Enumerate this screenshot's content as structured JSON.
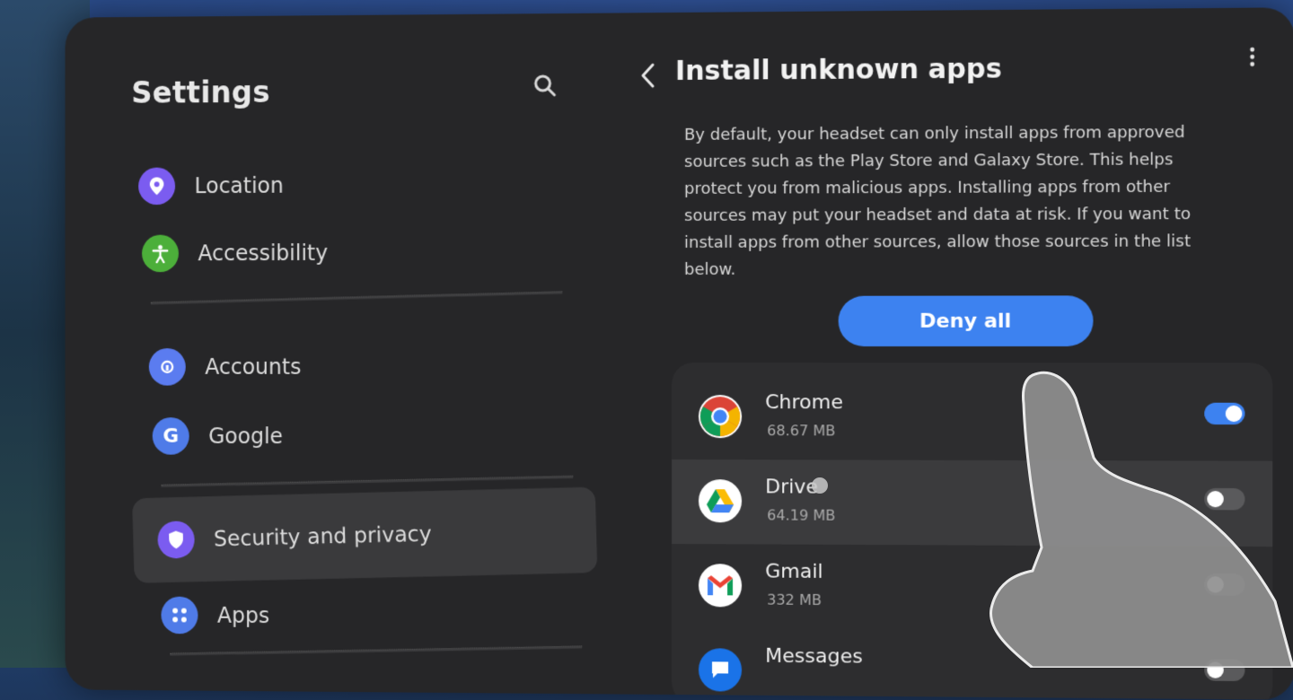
{
  "sidebar": {
    "title": "Settings",
    "items": [
      {
        "label": "Location",
        "icon": "location-pin-icon",
        "color": "#7b5cf0"
      },
      {
        "label": "Accessibility",
        "icon": "accessibility-person-icon",
        "color": "#4caf3a"
      },
      {
        "label": "Accounts",
        "icon": "key-icon",
        "color": "#5b7cf0"
      },
      {
        "label": "Google",
        "icon": "google-g-icon",
        "color": "#4f7be8"
      },
      {
        "label": "Security and privacy",
        "icon": "shield-icon",
        "color": "#7b5cf0",
        "selected": true
      },
      {
        "label": "Apps",
        "icon": "apps-grid-icon",
        "color": "#4f7be8"
      }
    ]
  },
  "detail": {
    "title": "Install unknown apps",
    "description": "By default, your headset can only install apps from approved sources such as the Play Store and Galaxy Store. This helps protect you from malicious apps. Installing apps from other sources may put your headset and data at risk. If you want to install apps from other sources, allow those sources in the list below.",
    "deny_all_label": "Deny all"
  },
  "apps": [
    {
      "name": "Chrome",
      "size": "68.67 MB",
      "icon": "chrome-icon",
      "enabled": true
    },
    {
      "name": "Drive",
      "size": "64.19 MB",
      "icon": "drive-icon",
      "enabled": false
    },
    {
      "name": "Gmail",
      "size": "332 MB",
      "icon": "gmail-icon",
      "enabled": false
    },
    {
      "name": "Messages",
      "size": "",
      "icon": "messages-icon",
      "enabled": false
    }
  ],
  "colors": {
    "accent": "#3d82f0",
    "panel": "#262628",
    "list_bg": "#2d2d2f"
  }
}
